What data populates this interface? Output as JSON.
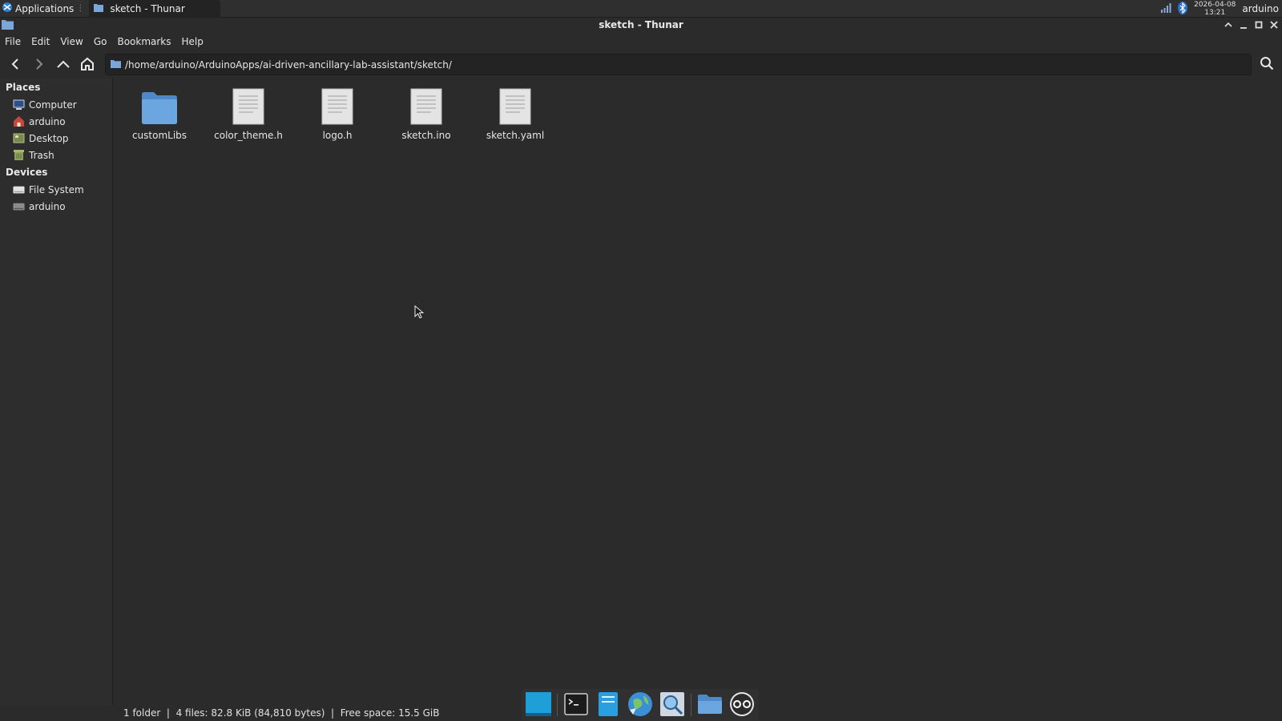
{
  "panel": {
    "applications_label": "Applications",
    "task_title": "sketch - Thunar",
    "clock_date": "2026-04-08",
    "clock_time": "13:21",
    "user": "arduino"
  },
  "window": {
    "title": "sketch - Thunar"
  },
  "menubar": {
    "items": [
      "File",
      "Edit",
      "View",
      "Go",
      "Bookmarks",
      "Help"
    ]
  },
  "toolbar": {
    "location_path": "/home/arduino/ArduinoApps/ai-driven-ancillary-lab-assistant/sketch/"
  },
  "sidebar": {
    "places_heading": "Places",
    "places": [
      {
        "label": "Computer",
        "icon": "computer-icon"
      },
      {
        "label": "arduino",
        "icon": "home-icon"
      },
      {
        "label": "Desktop",
        "icon": "desktop-icon"
      },
      {
        "label": "Trash",
        "icon": "trash-icon"
      }
    ],
    "devices_heading": "Devices",
    "devices": [
      {
        "label": "File System",
        "icon": "drive-icon"
      },
      {
        "label": "arduino",
        "icon": "drive-icon"
      }
    ]
  },
  "files": [
    {
      "name": "customLibs",
      "type": "folder"
    },
    {
      "name": "color_theme.h",
      "type": "file"
    },
    {
      "name": "logo.h",
      "type": "file"
    },
    {
      "name": "sketch.ino",
      "type": "file"
    },
    {
      "name": "sketch.yaml",
      "type": "file"
    }
  ],
  "statusbar": {
    "text": "1 folder  |  4 files: 82.8 KiB (84,810 bytes)  |  Free space: 15.5 GiB"
  },
  "colors": {
    "background": "#2b2b2b",
    "folder_blue": "#5b9bd5",
    "dock_accent": "#1e9fd8"
  }
}
